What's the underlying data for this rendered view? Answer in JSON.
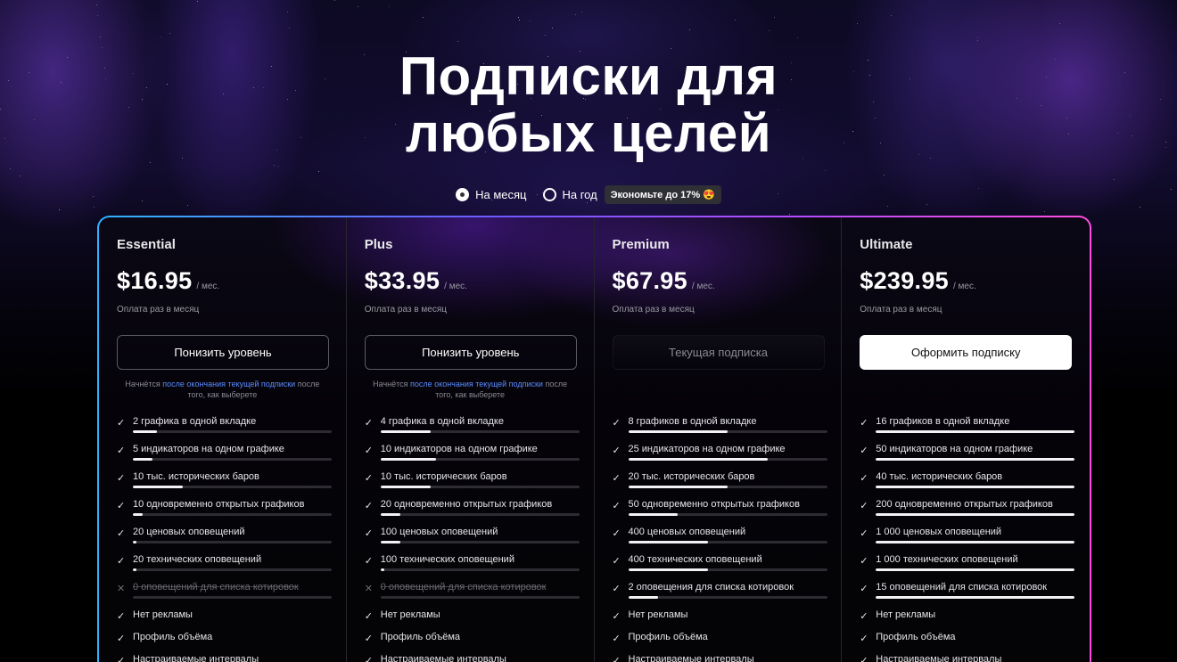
{
  "page": {
    "title_line1": "Подписки для",
    "title_line2": "любых целей"
  },
  "billing_toggle": {
    "monthly_label": "На месяц",
    "yearly_label": "На год",
    "selected": "monthly",
    "save_badge": "Экономьте до 17% 😍"
  },
  "colors": {
    "panel_border_start": "#2fb4ff",
    "panel_border_end": "#ff4ce2",
    "link": "#5b8cff"
  },
  "plans": [
    {
      "name": "Essential",
      "price": "$16.95",
      "per": "/ мес.",
      "billing": "Оплата раз в месяц",
      "button": "Понизить уровень",
      "button_style": "outline",
      "note_prefix": "Начнётся ",
      "note_link": "после окончания текущей подписки",
      "note_suffix": " после того, как выберете",
      "features": [
        {
          "text": "2 графика в одной вкладке",
          "included": true,
          "level": 0.12
        },
        {
          "text": "5 индикаторов на одном графике",
          "included": true,
          "level": 0.1
        },
        {
          "text": "10 тыс. исторических баров",
          "included": true,
          "level": 0.25
        },
        {
          "text": "10 одновременно открытых графиков",
          "included": true,
          "level": 0.05
        },
        {
          "text": "20 ценовых оповещений",
          "included": true,
          "level": 0.02
        },
        {
          "text": "20 технических оповещений",
          "included": true,
          "level": 0.02
        },
        {
          "text": "0 оповещений для списка котировок",
          "included": false,
          "level": 0
        },
        {
          "text": "Нет рекламы",
          "included": true,
          "plain": true
        },
        {
          "text": "Профиль объёма",
          "included": true,
          "plain": true
        },
        {
          "text": "Настраиваемые интервалы",
          "included": true,
          "plain": true
        }
      ]
    },
    {
      "name": "Plus",
      "price": "$33.95",
      "per": "/ мес.",
      "billing": "Оплата раз в месяц",
      "button": "Понизить уровень",
      "button_style": "outline",
      "note_prefix": "Начнётся ",
      "note_link": "после окончания текущей подписки",
      "note_suffix": " после того, как выберете",
      "features": [
        {
          "text": "4 графика в одной вкладке",
          "included": true,
          "level": 0.25
        },
        {
          "text": "10 индикаторов на одном графике",
          "included": true,
          "level": 0.28
        },
        {
          "text": "10 тыс. исторических баров",
          "included": true,
          "level": 0.25
        },
        {
          "text": "20 одновременно открытых графиков",
          "included": true,
          "level": 0.1
        },
        {
          "text": "100 ценовых оповещений",
          "included": true,
          "level": 0.1
        },
        {
          "text": "100 технических оповещений",
          "included": true,
          "level": 0.02
        },
        {
          "text": "0 оповещений для списка котировок",
          "included": false,
          "level": 0
        },
        {
          "text": "Нет рекламы",
          "included": true,
          "plain": true
        },
        {
          "text": "Профиль объёма",
          "included": true,
          "plain": true
        },
        {
          "text": "Настраиваемые интервалы",
          "included": true,
          "plain": true
        }
      ]
    },
    {
      "name": "Premium",
      "price": "$67.95",
      "per": "/ мес.",
      "billing": "Оплата раз в месяц",
      "button": "Текущая подписка",
      "button_style": "ghost",
      "features": [
        {
          "text": "8 графиков в одной вкладке",
          "included": true,
          "level": 0.5
        },
        {
          "text": "25 индикаторов на одном графике",
          "included": true,
          "level": 0.7
        },
        {
          "text": "20 тыс. исторических баров",
          "included": true,
          "level": 0.5
        },
        {
          "text": "50 одновременно открытых графиков",
          "included": true,
          "level": 0.25
        },
        {
          "text": "400 ценовых оповещений",
          "included": true,
          "level": 0.4
        },
        {
          "text": "400 технических оповещений",
          "included": true,
          "level": 0.4
        },
        {
          "text": "2 оповещения для списка котировок",
          "included": true,
          "level": 0.15
        },
        {
          "text": "Нет рекламы",
          "included": true,
          "plain": true
        },
        {
          "text": "Профиль объёма",
          "included": true,
          "plain": true
        },
        {
          "text": "Настраиваемые интервалы",
          "included": true,
          "plain": true
        }
      ]
    },
    {
      "name": "Ultimate",
      "price": "$239.95",
      "per": "/ мес.",
      "billing": "Оплата раз в месяц",
      "button": "Оформить подписку",
      "button_style": "solid",
      "features": [
        {
          "text": "16 графиков в одной вкладке",
          "included": true,
          "level": 1.0
        },
        {
          "text": "50 индикаторов на одном графике",
          "included": true,
          "level": 1.0
        },
        {
          "text": "40 тыс. исторических баров",
          "included": true,
          "level": 1.0
        },
        {
          "text": "200 одновременно открытых графиков",
          "included": true,
          "level": 1.0
        },
        {
          "text": "1 000 ценовых оповещений",
          "included": true,
          "level": 1.0
        },
        {
          "text": "1 000 технических оповещений",
          "included": true,
          "level": 1.0
        },
        {
          "text": "15 оповещений для списка котировок",
          "included": true,
          "level": 1.0
        },
        {
          "text": "Нет рекламы",
          "included": true,
          "plain": true
        },
        {
          "text": "Профиль объёма",
          "included": true,
          "plain": true
        },
        {
          "text": "Настраиваемые интервалы",
          "included": true,
          "plain": true
        }
      ]
    }
  ]
}
